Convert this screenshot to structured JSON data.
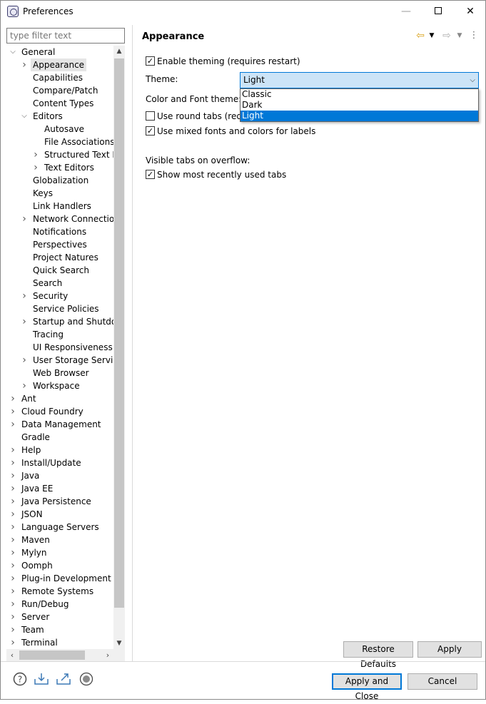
{
  "window": {
    "title": "Preferences",
    "minimize_glyph": "—",
    "close_glyph": "✕"
  },
  "filter": {
    "placeholder": "type filter text"
  },
  "tree": [
    {
      "label": "General",
      "expanded": true
    },
    {
      "label": "Appearance",
      "selected": true
    },
    {
      "label": "Capabilities"
    },
    {
      "label": "Compare/Patch"
    },
    {
      "label": "Content Types"
    },
    {
      "label": "Editors",
      "expanded": true
    },
    {
      "label": "Autosave"
    },
    {
      "label": "File Associations"
    },
    {
      "label": "Structured Text Ec"
    },
    {
      "label": "Text Editors"
    },
    {
      "label": "Globalization"
    },
    {
      "label": "Keys"
    },
    {
      "label": "Link Handlers"
    },
    {
      "label": "Network Connection:"
    },
    {
      "label": "Notifications"
    },
    {
      "label": "Perspectives"
    },
    {
      "label": "Project Natures"
    },
    {
      "label": "Quick Search"
    },
    {
      "label": "Search"
    },
    {
      "label": "Security"
    },
    {
      "label": "Service Policies"
    },
    {
      "label": "Startup and Shutdow"
    },
    {
      "label": "Tracing"
    },
    {
      "label": "UI Responsiveness M"
    },
    {
      "label": "User Storage Service"
    },
    {
      "label": "Web Browser"
    },
    {
      "label": "Workspace"
    },
    {
      "label": "Ant"
    },
    {
      "label": "Cloud Foundry"
    },
    {
      "label": "Data Management"
    },
    {
      "label": "Gradle"
    },
    {
      "label": "Help"
    },
    {
      "label": "Install/Update"
    },
    {
      "label": "Java"
    },
    {
      "label": "Java EE"
    },
    {
      "label": "Java Persistence"
    },
    {
      "label": "JSON"
    },
    {
      "label": "Language Servers"
    },
    {
      "label": "Maven"
    },
    {
      "label": "Mylyn"
    },
    {
      "label": "Oomph"
    },
    {
      "label": "Plug-in Development"
    },
    {
      "label": "Remote Systems"
    },
    {
      "label": "Run/Debug"
    },
    {
      "label": "Server"
    },
    {
      "label": "Team"
    },
    {
      "label": "Terminal"
    }
  ],
  "page": {
    "title": "Appearance",
    "enable_theming": {
      "label": "Enable theming (requires restart)",
      "checked": true
    },
    "theme_label": "Theme:",
    "theme_value": "Light",
    "theme_options": [
      "Classic",
      "Dark",
      "Light"
    ],
    "color_font_label": "Color and Font theme:",
    "round_tabs": {
      "label": "Use round tabs (requi",
      "checked": false
    },
    "mixed_fonts": {
      "label": "Use mixed fonts and colors for labels",
      "checked": true
    },
    "visible_tabs_label": "Visible tabs on overflow:",
    "recent_tabs": {
      "label": "Show most recently used tabs",
      "checked": true
    },
    "restore_defaults": "Restore Defaults",
    "apply": "Apply"
  },
  "footer": {
    "apply_close": "Apply and Close",
    "cancel": "Cancel"
  },
  "icons": [
    "help-icon",
    "import-icon",
    "export-icon",
    "record-icon"
  ]
}
